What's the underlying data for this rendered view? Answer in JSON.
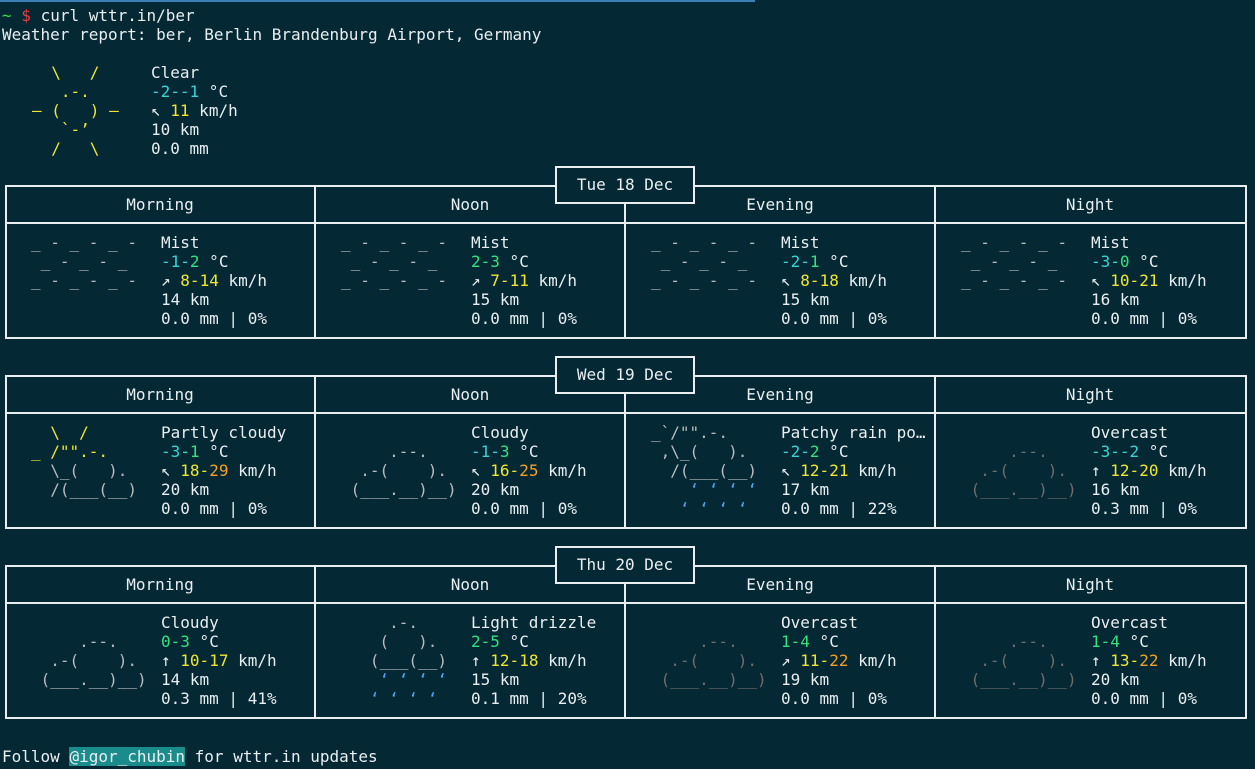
{
  "terminal": {
    "prompt_tilde": "~",
    "prompt_dollar": "$",
    "command": "curl wttr.in/ber",
    "report_title": "Weather report: ber, Berlin Brandenburg Airport, Germany"
  },
  "current": {
    "icon": [
      "  \\   /  ",
      "   .-.   ",
      "― (   ) ―",
      "   `-’   ",
      "  /   \\  "
    ],
    "condition": "Clear",
    "temp_low": "-2",
    "temp_high": "-1",
    "temp_unit": " °C",
    "wind_arrow": "↖",
    "wind": "11",
    "wind_unit": " km/h",
    "visibility": "10 km",
    "precip": "0.0 mm"
  },
  "colors": {
    "background": "#042934",
    "text": "#e9eef0",
    "sun_yellow": "#f0e62f",
    "wind_orange": "#f2a027",
    "temp_cyan": "#37d6d6",
    "temp_green": "#35e27f",
    "cloud_gray": "#b8bcbe",
    "overcast_gray": "#6e6d6a",
    "rain_blue": "#52a6ef"
  },
  "periods": [
    "Morning",
    "Noon",
    "Evening",
    "Night"
  ],
  "days": [
    {
      "date": "Tue 18 Dec",
      "slots": [
        {
          "icon": [
            "_ - _ - _ - ",
            " _ - _ - _  ",
            "_ - _ - _ - "
          ],
          "cond": "Mist",
          "t1": "-1",
          "t2": "2",
          "arrow": "↗",
          "w1": "8",
          "w2": "14",
          "vis": "14 km",
          "precip": "0.0 mm | 0%"
        },
        {
          "icon": [
            "_ - _ - _ - ",
            " _ - _ - _  ",
            "_ - _ - _ - "
          ],
          "cond": "Mist",
          "t1": "2",
          "t2": "3",
          "arrow": "↗",
          "w1": "7",
          "w2": "11",
          "vis": "15 km",
          "precip": "0.0 mm | 0%"
        },
        {
          "icon": [
            "_ - _ - _ - ",
            " _ - _ - _  ",
            "_ - _ - _ - "
          ],
          "cond": "Mist",
          "t1": "-2",
          "t2": "1",
          "arrow": "↖",
          "w1": "8",
          "w2": "18",
          "vis": "15 km",
          "precip": "0.0 mm | 0%"
        },
        {
          "icon": [
            "_ - _ - _ - ",
            " _ - _ - _  ",
            "_ - _ - _ - "
          ],
          "cond": "Mist",
          "t1": "-3",
          "t2": "0",
          "arrow": "↖",
          "w1": "10",
          "w2": "21",
          "vis": "16 km",
          "precip": "0.0 mm | 0%"
        }
      ]
    },
    {
      "date": "Wed 19 Dec",
      "slots": [
        {
          "icon": [
            "  \\  /      ",
            "_ /\"\".-.    ",
            "  \\_(   ).  ",
            "  /(___(__) "
          ],
          "cond": "Partly cloudy",
          "t1": "-3",
          "t2": "1",
          "arrow": "↖",
          "w1": "18",
          "w2": "29",
          "vis": "20 km",
          "precip": "0.0 mm | 0%"
        },
        {
          "icon": [
            "            ",
            "     .--.   ",
            "  .-(    ). ",
            " (___.__)__)"
          ],
          "cond": "Cloudy",
          "t1": "-1",
          "t2": "3",
          "arrow": "↖",
          "w1": "16",
          "w2": "25",
          "vis": "20 km",
          "precip": "0.0 mm | 0%"
        },
        {
          "icon": [
            "_`/\"\".-.    ",
            " ,\\_(   ).  ",
            "  /(___(__) ",
            "    ‘ ‘ ‘ ‘ ",
            "   ‘ ‘ ‘ ‘  "
          ],
          "cond": "Patchy rain po…",
          "t1": "-2",
          "t2": "2",
          "arrow": "↖",
          "w1": "12",
          "w2": "21",
          "vis": "17 km",
          "precip": "0.0 mm | 22%"
        },
        {
          "icon": [
            "            ",
            "     .--.   ",
            "  .-(    ). ",
            " (___.__)__)"
          ],
          "cond": "Overcast",
          "t1": "-3",
          "t2": "-2",
          "arrow": "↑",
          "w1": "12",
          "w2": "20",
          "vis": "16 km",
          "precip": "0.3 mm | 0%"
        }
      ]
    },
    {
      "date": "Thu 20 Dec",
      "slots": [
        {
          "icon": [
            "            ",
            "     .--.   ",
            "  .-(    ). ",
            " (___.__)__)"
          ],
          "cond": "Cloudy",
          "t1": "0",
          "t2": "3",
          "arrow": "↑",
          "w1": "10",
          "w2": "17",
          "vis": "14 km",
          "precip": "0.3 mm | 41%"
        },
        {
          "icon": [
            "     .-.    ",
            "    (   ).  ",
            "   (___(__) ",
            "    ‘ ‘ ‘ ‘ ",
            "   ‘ ‘ ‘ ‘  "
          ],
          "cond": "Light drizzle",
          "t1": "2",
          "t2": "5",
          "arrow": "↑",
          "w1": "12",
          "w2": "18",
          "vis": "15 km",
          "precip": "0.1 mm | 20%"
        },
        {
          "icon": [
            "            ",
            "     .--.   ",
            "  .-(    ). ",
            " (___.__)__)"
          ],
          "cond": "Overcast",
          "t1": "1",
          "t2": "4",
          "arrow": "↗",
          "w1": "11",
          "w2": "22",
          "vis": "19 km",
          "precip": "0.0 mm | 0%"
        },
        {
          "icon": [
            "            ",
            "     .--.   ",
            "  .-(    ). ",
            " (___.__)__)"
          ],
          "cond": "Overcast",
          "t1": "1",
          "t2": "4",
          "arrow": "↑",
          "w1": "13",
          "w2": "22",
          "vis": "20 km",
          "precip": "0.0 mm | 0%"
        }
      ]
    }
  ],
  "footer": {
    "follow": "Follow ",
    "handle": "@igor_chubin",
    "rest": " for wttr.in updates"
  }
}
